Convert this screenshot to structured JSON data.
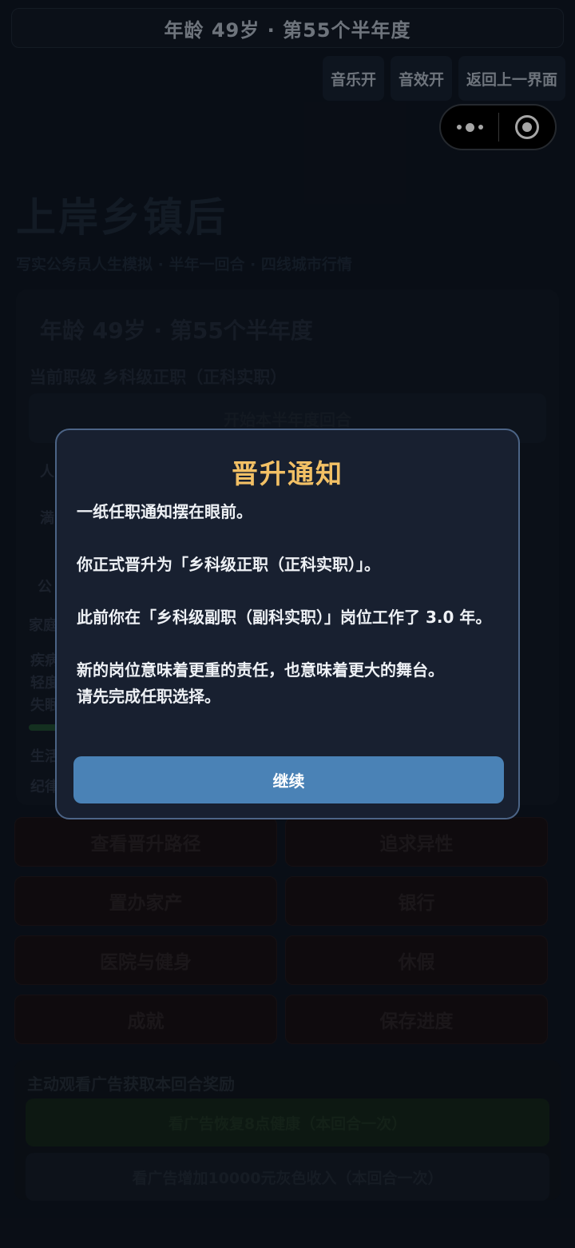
{
  "topbar": {
    "text": "年龄 49岁 · 第55个半年度"
  },
  "controls": {
    "music": "音乐开",
    "sfx": "音效开",
    "back": "返回上一界面"
  },
  "header": {
    "title": "上岸乡镇后",
    "subtitle": "写实公务员人生模拟 · 半年一回合 · 四线城市行情"
  },
  "status": {
    "age_line": "年龄 49岁 · 第55个半年度",
    "rank_line": "当前职级 乡科级正职（正科实职）",
    "start_round": "开始本半年度回合",
    "fragments": [
      "人",
      "満",
      "公",
      "家庭",
      "疾病",
      "轻度",
      "失眠",
      "生活",
      "纪律"
    ]
  },
  "actions": [
    "查看晋升路径",
    "追求异性",
    "置办家产",
    "银行",
    "医院与健身",
    "休假",
    "成就",
    "保存进度"
  ],
  "ads": {
    "title": "主动观看广告获取本回合奖励",
    "heal": "看广告恢复8点健康（本回合一次）",
    "income": "看广告增加10000元灰色收入（本回合一次）"
  },
  "modal": {
    "title": "晋升通知",
    "p1": "一纸任职通知摆在眼前。",
    "p2": "你正式晋升为「乡科级正职（正科实职）」。",
    "p3": "此前你在「乡科级副职（副科实职）」岗位工作了 3.0 年。",
    "p4a": "新的岗位意味着更重的责任，也意味着更大的舞台。",
    "p4b": "请先完成任职选择。",
    "continue": "继续"
  },
  "colors": {
    "accent_title": "#f2c065",
    "button": "#4a82b6",
    "modal_bg": "#182030",
    "modal_border": "#4c6486"
  }
}
